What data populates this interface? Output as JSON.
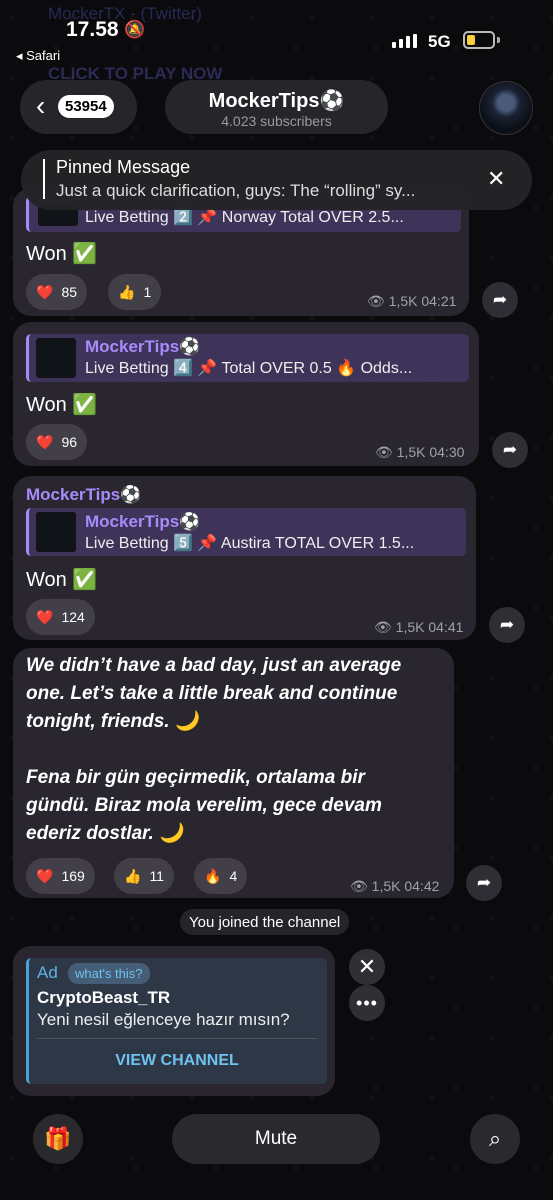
{
  "status_bar": {
    "time": "17.58",
    "back_app": "◂ Safari",
    "network": "5G"
  },
  "ghost_text": {
    "line1": "MockerTX - (Twitter)",
    "line2": "CLICK TO PLAY NOW"
  },
  "header": {
    "back_count": "53954",
    "title": "MockerTips⚽",
    "subtitle": "4.023 subscribers"
  },
  "pinned": {
    "title": "Pinned Message",
    "text": "Just a quick clarification, guys: The “rolling” sy..."
  },
  "messages": [
    {
      "quote_text": "Live Betting 2️⃣ 📌 Norway Total OVER 2.5...",
      "body": "Won ✅",
      "reactions": [
        {
          "emoji": "❤️",
          "count": "85"
        },
        {
          "emoji": "👍",
          "count": "1"
        }
      ],
      "meta": "👁 1,5K 04:21"
    },
    {
      "quote_name": "MockerTips⚽",
      "quote_text": "Live Betting 4️⃣ 📌 Total OVER 0.5 🔥 Odds...",
      "body": "Won ✅",
      "reactions": [
        {
          "emoji": "❤️",
          "count": "96"
        }
      ],
      "meta": "👁 1,5K 04:30"
    },
    {
      "author": "MockerTips⚽",
      "quote_name": "MockerTips⚽",
      "quote_text": "Live Betting 5️⃣ 📌 Austira TOTAL OVER 1.5...",
      "body": "Won ✅",
      "reactions": [
        {
          "emoji": "❤️",
          "count": "124"
        }
      ],
      "meta": "👁 1,5K 04:41"
    },
    {
      "body_lines": [
        "We didn’t have a bad day, just an average",
        "one. Let’s take a little break and continue",
        "tonight, friends. 🌙",
        "Fena bir gün geçirmedik, ortalama bir",
        "gündü. Biraz mola verelim, gece devam",
        "ederiz dostlar. 🌙"
      ],
      "reactions": [
        {
          "emoji": "❤️",
          "count": "169"
        },
        {
          "emoji": "👍",
          "count": "11"
        },
        {
          "emoji": "🔥",
          "count": "4"
        }
      ],
      "meta": "👁 1,5K 04:42"
    }
  ],
  "system": {
    "joined": "You joined the channel"
  },
  "ad": {
    "label": "Ad",
    "whats_this": "what's this?",
    "name": "CryptoBeast_TR",
    "desc": "Yeni nesil eğlenceye hazır mısın?",
    "button": "VIEW CHANNEL"
  },
  "bottom": {
    "mute": "Mute"
  },
  "icons": {
    "gift": "gift-icon",
    "search": "search-icon",
    "share": "share-icon",
    "close": "close-icon",
    "more": "more-icon"
  },
  "colors": {
    "accent": "#a78bfa",
    "link": "#6fc2f0",
    "battery": "#f6d23a"
  }
}
